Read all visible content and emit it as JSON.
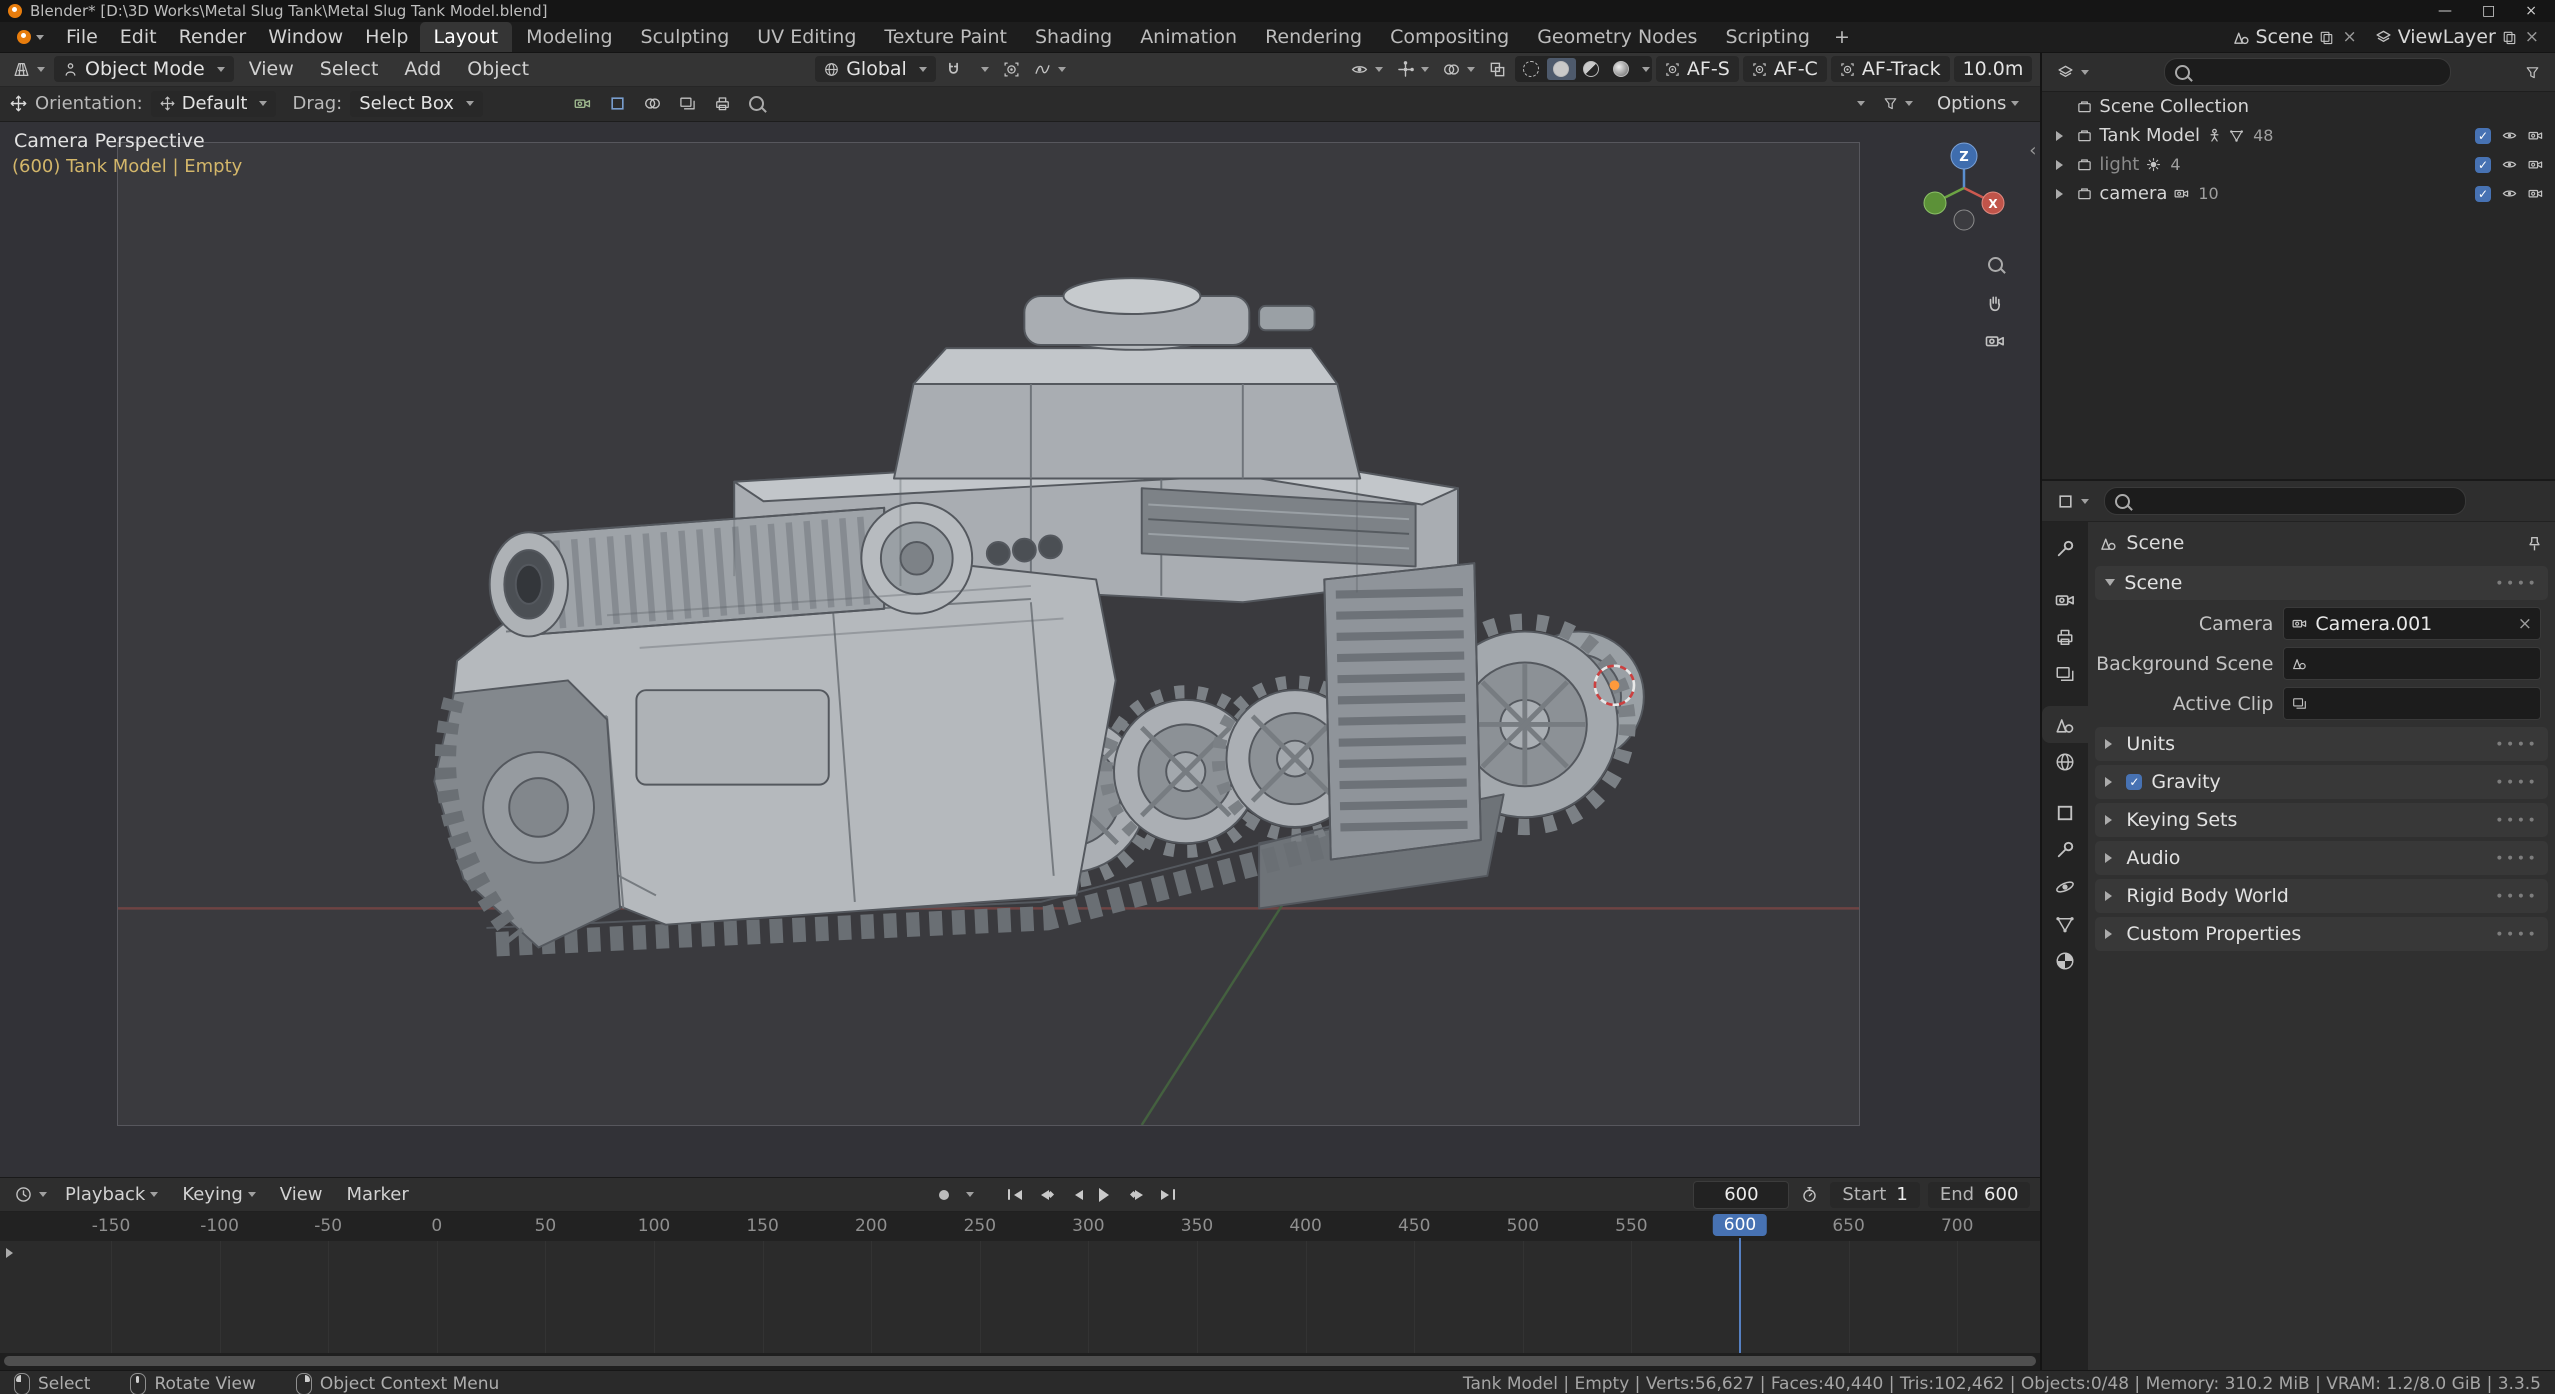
{
  "window": {
    "title": "Blender* [D:\\3D Works\\Metal Slug Tank\\Metal Slug Tank Model.blend]",
    "minimize": "—",
    "maximize": "□",
    "close": "×"
  },
  "colors": {
    "accent_blue": "#4772b3",
    "selection_orange": "#ff9a3c",
    "viewport_info_yellow": "#d3b66a"
  },
  "topbar": {
    "menus": [
      "File",
      "Edit",
      "Render",
      "Window",
      "Help"
    ],
    "workspaces": [
      "Layout",
      "Modeling",
      "Sculpting",
      "UV Editing",
      "Texture Paint",
      "Shading",
      "Animation",
      "Rendering",
      "Compositing",
      "Geometry Nodes",
      "Scripting"
    ],
    "add_workspace": "+",
    "scene": "Scene",
    "view_layer": "ViewLayer"
  },
  "viewport_header": {
    "mode": "Object Mode",
    "menus": [
      "View",
      "Select",
      "Add",
      "Object"
    ],
    "orientation": "Global",
    "af_s": "AF-S",
    "af_c": "AF-C",
    "af_track": "AF-Track",
    "focus_distance": "10.0m"
  },
  "tool_row": {
    "orientation_label": "Orientation:",
    "orientation_value": "Default",
    "drag_label": "Drag:",
    "drag_value": "Select Box",
    "options": "Options"
  },
  "viewport": {
    "view_label": "Camera Perspective",
    "object_info": "(600) Tank Model | Empty",
    "gizmo_axes": {
      "z": "Z",
      "x": "X"
    },
    "collapse_arrow": "‹"
  },
  "outliner": {
    "root_label": "Scene Collection",
    "items": [
      {
        "label": "Tank Model",
        "count": "48"
      },
      {
        "label": "light",
        "count": "4"
      },
      {
        "label": "camera",
        "count": "10"
      }
    ]
  },
  "properties": {
    "breadcrumb": "Scene",
    "tab_icons": [
      "tool",
      "render",
      "output",
      "view-layer",
      "scene",
      "world",
      "object",
      "modifiers",
      "physics",
      "object-data",
      "material"
    ],
    "scene_panel": {
      "title": "Scene",
      "camera_label": "Camera",
      "camera_value": "Camera.001",
      "background_label": "Background Scene",
      "active_clip_label": "Active Clip"
    },
    "collapsed_panels": [
      "Units",
      "Gravity",
      "Keying Sets",
      "Audio",
      "Rigid Body World",
      "Custom Properties"
    ],
    "grip": "∙∙∙∙"
  },
  "timeline": {
    "menus": [
      "Playback",
      "Keying",
      "View",
      "Marker"
    ],
    "current_frame": "600",
    "start_label": "Start",
    "start_value": "1",
    "end_label": "End",
    "end_value": "600",
    "ticks": [
      "-150",
      "-100",
      "-50",
      "0",
      "50",
      "100",
      "150",
      "200",
      "250",
      "300",
      "350",
      "400",
      "450",
      "500",
      "550",
      "600",
      "650",
      "700"
    ]
  },
  "statusbar": {
    "hints": [
      {
        "label": "Select"
      },
      {
        "label": "Rotate View"
      },
      {
        "label": "Object Context Menu"
      }
    ],
    "stats": "Tank Model | Empty | Verts:56,627 | Faces:40,440 | Tris:102,462 | Objects:0/48 | Memory: 310.2 MiB | VRAM: 1.2/8.0 GiB | 3.3.5"
  }
}
